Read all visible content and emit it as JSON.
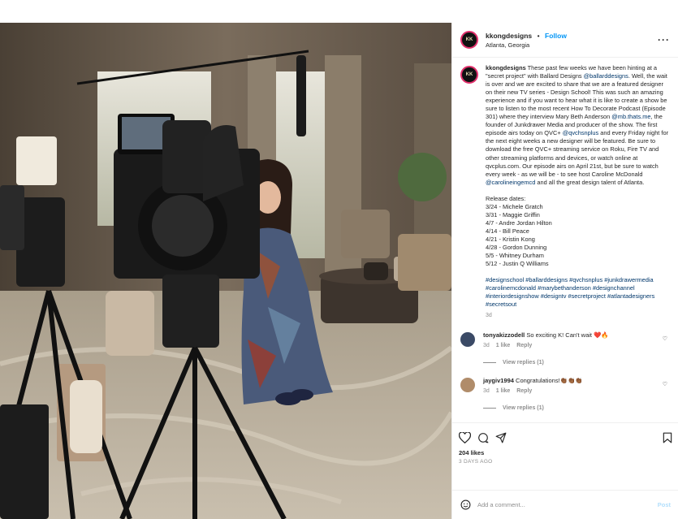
{
  "post": {
    "username": "kkongdesigns",
    "avatar_text": "KK",
    "follow_label": "Follow",
    "separator": "•",
    "location": "Atlanta, Georgia",
    "more_label": "···",
    "photo_alt": "Woman in a floral dress seated in a living room during a TV filming, with cameras in the foreground"
  },
  "caption": {
    "t1": " These past few weeks we have been hinting at a \"secret project\" with Ballard Designs ",
    "m1": "@ballarddesigns",
    "t2": ". Well, the wait is over and we are excited to share that we are a featured designer on their new TV series - Design School! This was such an amazing experience and if you want to hear what it is like to create a show be sure to listen to the most recent How To Decorate Podcast (Episode 301) where they interview Mary Beth Anderson ",
    "m2": "@mb.thats.me",
    "t3": ", the founder of Junkdrawer Media and producer of the show. The first episode airs today on QVC+ ",
    "m3": "@qvchsnplus",
    "t4": " and every Friday night for the next eight weeks a new designer will be featured. Be sure to download the free QVC+ streaming service on Roku, Fire TV and other streaming platforms and devices, or watch online at qvcplus.com. Our episode airs on April 21st, but be sure to watch every week - as we will be - to see host Caroline McDonald ",
    "m4": "@carolineingemcd",
    "t5": " and all the great design talent of Atlanta.",
    "release_title": "Release dates:",
    "release": [
      "3/24 - Michele Gratch",
      "3/31 - Maggie Griffin",
      "4/7 - Andre Jordan Hilton",
      "4/14 - Bill Peace",
      "4/21 - Kristin Kong",
      "4/28 - Gordon Dunning",
      "5/5 - Whitney Durham",
      "5/12 - Justin Q Williams"
    ],
    "hashtags": "#designschool #ballarddesigns #qvchsnplus #junkdrawermedia #carolinemcdonald #marybethanderson #designchannel #interiordesignshow #designtv #secretproject #atlantadesigners #secretsout",
    "time": "3d"
  },
  "comments": [
    {
      "username": "tonyakizzodell",
      "text": " So exciting K! Can't wait ❤️🔥",
      "time": "3d",
      "likes": "1 like",
      "reply": "Reply",
      "view_replies": "View replies (1)"
    },
    {
      "username": "jaygiv1994",
      "text": " Congratulations!👏🏾👏🏾👏🏾",
      "time": "3d",
      "likes": "1 like",
      "reply": "Reply",
      "view_replies": "View replies (1)"
    }
  ],
  "actions": {
    "likes": "204 likes",
    "date": "3 DAYS AGO"
  },
  "add_comment": {
    "placeholder": "Add a comment...",
    "post_label": "Post"
  },
  "colors": {
    "accent": "#0095f6",
    "post_disabled": "#b2dffc",
    "muted": "#8e8e8e"
  }
}
